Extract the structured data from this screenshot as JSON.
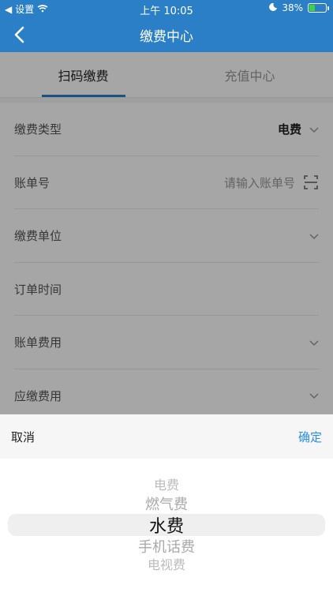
{
  "status": {
    "back_app": "设置",
    "time": "上午 10:05",
    "battery": "38%",
    "battery_level": 0.38
  },
  "nav": {
    "title": "缴费中心"
  },
  "tabs": [
    {
      "label": "扫码缴费",
      "active": true
    },
    {
      "label": "充值中心",
      "active": false
    }
  ],
  "form": {
    "fee_type": {
      "label": "缴费类型",
      "value": "电费"
    },
    "bill_no": {
      "label": "账单号",
      "placeholder": "请输入账单号"
    },
    "unit": {
      "label": "缴费单位"
    },
    "order_time": {
      "label": "订单时间"
    },
    "bill_amount": {
      "label": "账单费用"
    },
    "payable": {
      "label": "应缴费用"
    }
  },
  "picker": {
    "cancel": "取消",
    "confirm": "确定",
    "options": [
      "电费",
      "燃气费",
      "水费",
      "手机话费",
      "电视费"
    ],
    "selected": "水费"
  },
  "colors": {
    "brand": "#2b7fc7",
    "confirm": "#2b8fe8",
    "battery_fill": "#39d24a"
  }
}
